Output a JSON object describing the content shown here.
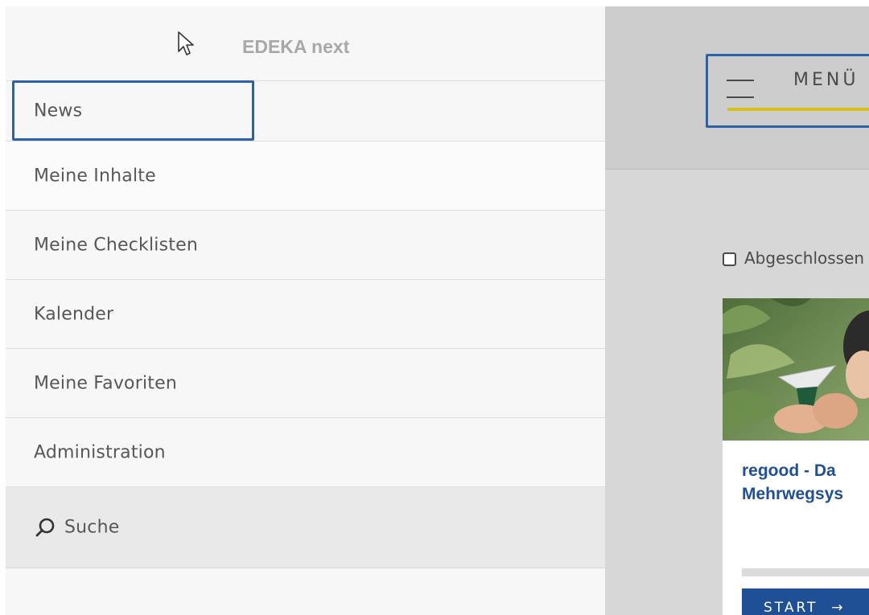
{
  "drawer": {
    "brand": "EDEKA next",
    "items": [
      {
        "label": "News"
      },
      {
        "label": "Meine Inhalte"
      },
      {
        "label": "Meine Checklisten"
      },
      {
        "label": "Kalender"
      },
      {
        "label": "Meine Favoriten"
      },
      {
        "label": "Administration"
      }
    ],
    "search": {
      "label": "Suche",
      "icon": "search-icon"
    }
  },
  "header": {
    "menu_label": "MENÜ",
    "menu_icon": "hamburger-icon"
  },
  "filter": {
    "checkbox_label": "Abgeschlossen",
    "checked": false
  },
  "card": {
    "title_line1": "regood - Da",
    "title_line2": "Mehrwegsys",
    "start_label": "START",
    "start_icon": "arrow-right-icon"
  },
  "colors": {
    "accent_blue": "#1f4f94",
    "highlight_blue": "#2b62a8",
    "underline_yellow": "#d4c020",
    "brand_gray": "#a8a8a8"
  }
}
